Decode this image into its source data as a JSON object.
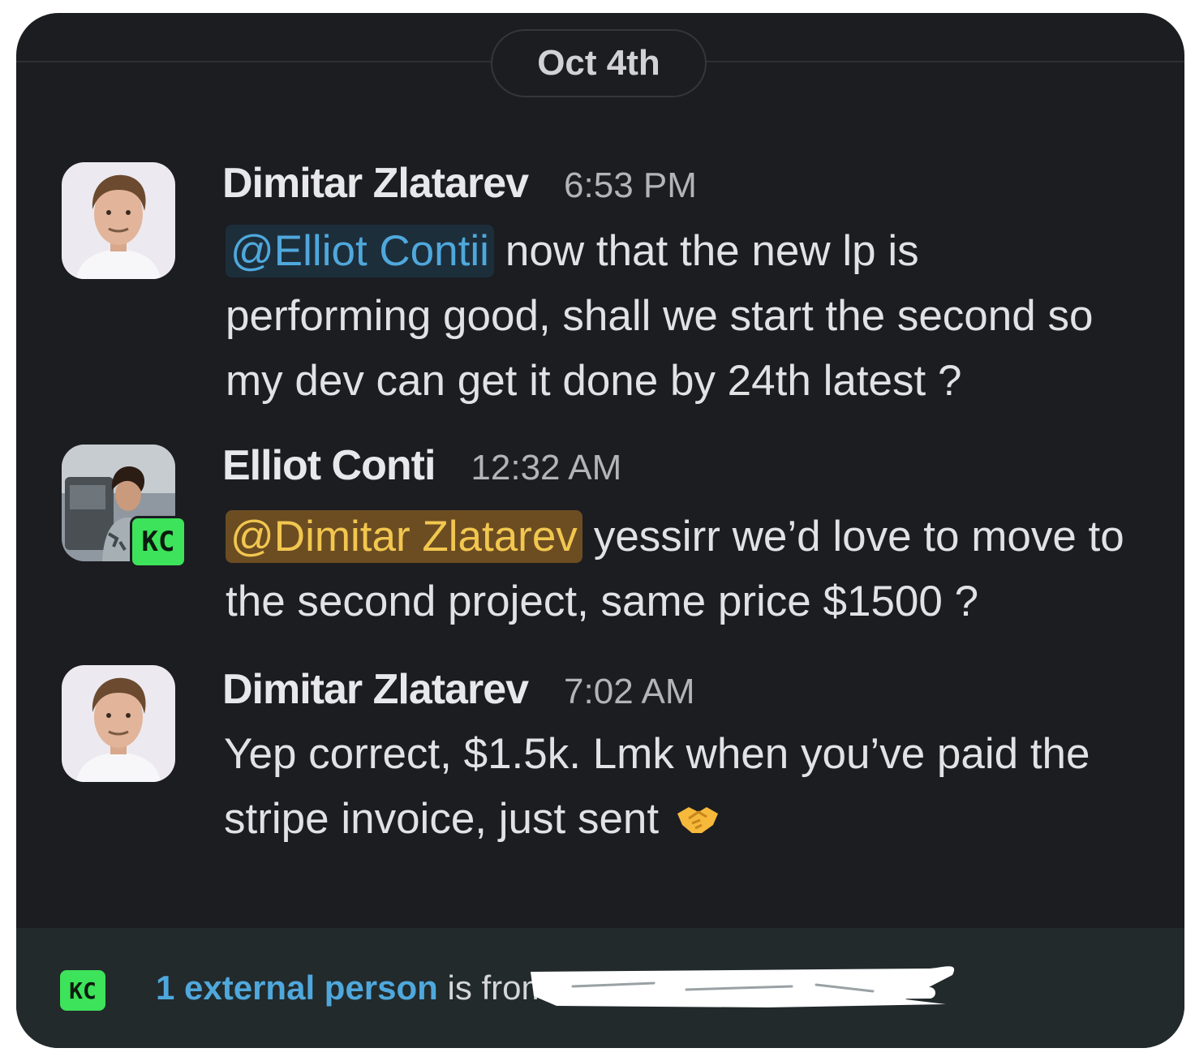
{
  "date_divider": {
    "label": "Oct 4th"
  },
  "messages": [
    {
      "sender": "Dimitar Zlatarev",
      "time": "6:53 PM",
      "mention": "@Elliot Contii",
      "text": "now that the new lp is performing good, shall we start the second so my dev can get it done by 24th latest ?"
    },
    {
      "sender": "Elliot Conti",
      "time": "12:32 AM",
      "badge": "KC",
      "mention": "@Dimitar Zlatarev",
      "text": "yessirr we’d love to move to the second project, same price $1500 ?"
    },
    {
      "sender": "Dimitar Zlatarev",
      "time": "7:02 AM",
      "text": "Yep correct, $1.5k. Lmk when you’ve paid the stripe invoice, just sent",
      "emoji": "handshake-icon"
    }
  ],
  "footer": {
    "badge": "KC",
    "link": "1 external person",
    "text": "is from"
  },
  "colors": {
    "background": "#1b1d21",
    "mention_blue": "#4fa8dc",
    "mention_self": "#f2c74f",
    "external_badge": "#3de35a"
  }
}
